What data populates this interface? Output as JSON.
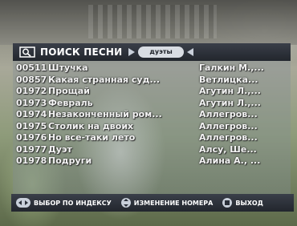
{
  "header": {
    "title": "ПОИСК ПЕСНИ",
    "filter": "дуэты"
  },
  "songs": [
    {
      "num": "00511",
      "title": "Штучка",
      "artist": "Галкин М.,..."
    },
    {
      "num": "00857",
      "title": "Какая странная суд...",
      "artist": "Ветлицка..."
    },
    {
      "num": "01972",
      "title": "Прощай",
      "artist": "Агутин Л.,..."
    },
    {
      "num": "01973",
      "title": "Февраль",
      "artist": "Агутин Л.,..."
    },
    {
      "num": "01974",
      "title": "Незаконченный ром...",
      "artist": "Аллегров..."
    },
    {
      "num": "01975",
      "title": "Столик на двоих",
      "artist": "Аллегров..."
    },
    {
      "num": "01976",
      "title": "Но все-таки лето",
      "artist": "Аллегров..."
    },
    {
      "num": "01977",
      "title": "Дуэт",
      "artist": "Алсу, Ше..."
    },
    {
      "num": "01978",
      "title": "Подруги",
      "artist": "Алина А., ..."
    }
  ],
  "footer": {
    "index_label": "ВЫБОР ПО ИНДЕКСУ",
    "number_label": "ИЗМЕНЕНИЕ НОМЕРА",
    "exit_label": "ВЫХОД"
  }
}
